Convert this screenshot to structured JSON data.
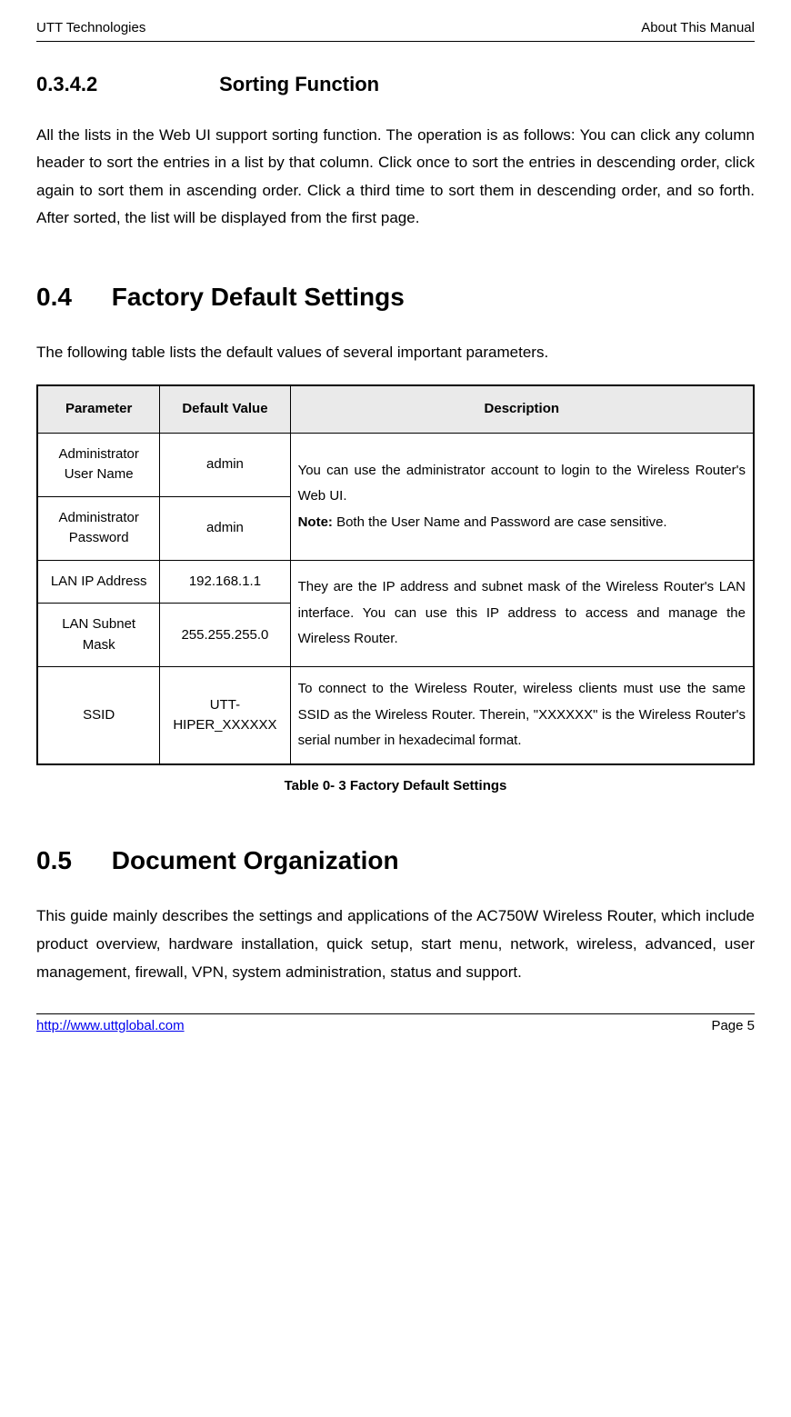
{
  "header": {
    "left": "UTT Technologies",
    "right": "About This Manual"
  },
  "section_0342": {
    "num": "0.3.4.2",
    "title": "Sorting Function",
    "body": "All the lists in the Web UI support sorting function. The operation is as follows: You can click any column header to sort the entries in a list by that column. Click once to sort the entries in descending order, click again to sort them in ascending order. Click a third time to sort them in descending order, and so forth. After sorted, the list will be displayed from the first page."
  },
  "section_04": {
    "num": "0.4",
    "title": "Factory Default Settings",
    "intro": "The following table lists the default values of several important parameters.",
    "table": {
      "headers": [
        "Parameter",
        "Default Value",
        "Description"
      ],
      "rows": [
        {
          "param": "Administrator User Name",
          "value": "admin"
        },
        {
          "param": "Administrator Password",
          "value": "admin"
        },
        {
          "param": "LAN IP Address",
          "value": "192.168.1.1"
        },
        {
          "param": "LAN Subnet Mask",
          "value": "255.255.255.0"
        },
        {
          "param": "SSID",
          "value": "UTT-HIPER_XXXXXX"
        }
      ],
      "desc1_a": "You can use the administrator account to login to the Wireless Router's Web UI.",
      "desc1_note_label": "Note: ",
      "desc1_note_body": "Both the User Name and Password are case sensitive.",
      "desc2": "They are the IP address and subnet mask of the Wireless Router's LAN interface. You can use this IP address to access and manage the Wireless Router.",
      "desc3": "To connect to the Wireless Router, wireless clients must use the same SSID as the Wireless Router. Therein, \"XXXXXX\" is the Wireless Router's serial number in hexadecimal format."
    },
    "caption": "Table 0- 3 Factory Default Settings"
  },
  "section_05": {
    "num": "0.5",
    "title": "Document Organization",
    "body": "This guide mainly describes the settings and applications of the AC750W Wireless Router, which include product overview, hardware installation, quick setup, start menu, network, wireless, advanced, user management, firewall, VPN, system administration, status and support."
  },
  "footer": {
    "link": "http://www.uttglobal.com",
    "page": "Page 5"
  }
}
